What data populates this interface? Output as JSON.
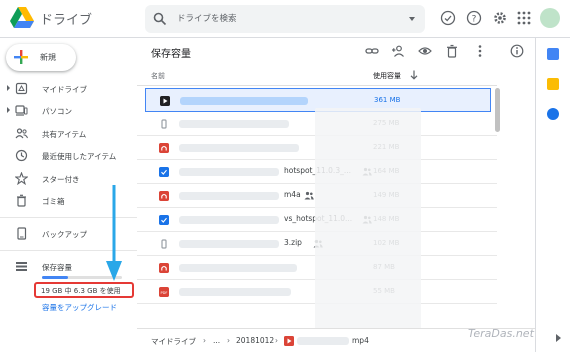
{
  "app": {
    "name": "ドライブ",
    "logo": "drive-logo"
  },
  "search": {
    "placeholder": "ドライブを検索"
  },
  "header_icons": [
    "offline-check-icon",
    "help-icon",
    "settings-icon",
    "apps-grid-icon",
    "account-avatar"
  ],
  "new_button": {
    "label": "新規"
  },
  "sidebar": {
    "items": [
      {
        "label": "マイドライブ",
        "icon": "my-drive-icon",
        "expandable": true
      },
      {
        "label": "パソコン",
        "icon": "computers-icon",
        "expandable": true
      },
      {
        "label": "共有アイテム",
        "icon": "shared-icon",
        "expandable": false
      },
      {
        "label": "最近使用したアイテム",
        "icon": "recent-icon",
        "expandable": false
      },
      {
        "label": "スター付き",
        "icon": "star-icon",
        "expandable": false
      },
      {
        "label": "ゴミ箱",
        "icon": "trash-icon",
        "expandable": false
      },
      {
        "label": "バックアップ",
        "icon": "backup-icon",
        "expandable": false
      },
      {
        "label": "保存容量",
        "icon": "storage-icon",
        "expandable": false
      }
    ],
    "storage": {
      "usage_text": "19 GB 中 6.3 GB を使用",
      "used_fraction": 0.33,
      "upgrade_label": "容量をアップグレード"
    }
  },
  "main": {
    "title": "保存容量",
    "toolbar": [
      "link-icon",
      "add-person-icon",
      "preview-eye-icon",
      "trash-icon",
      "more-vert-icon",
      "info-icon"
    ],
    "columns": {
      "name": "名前",
      "size": "使用容量"
    },
    "files": [
      {
        "name": "",
        "size": "361 MB",
        "type": "video",
        "color": "#202124",
        "selected": true,
        "shared": false
      },
      {
        "name": "",
        "size": "275 MB",
        "type": "generic",
        "color": "#9aa0a6",
        "selected": false,
        "shared": false
      },
      {
        "name": "",
        "size": "221 MB",
        "type": "audio",
        "color": "#db4437",
        "selected": false,
        "shared": false
      },
      {
        "name": "hotspot_11.0.3_...",
        "size": "164 MB",
        "type": "doc",
        "color": "#1a73e8",
        "selected": false,
        "shared": true
      },
      {
        "name": "m4a",
        "size": "149 MB",
        "type": "audio",
        "color": "#db4437",
        "selected": false,
        "shared": true
      },
      {
        "name": "vs_hotspot_11.0...",
        "size": "148 MB",
        "type": "doc",
        "color": "#1a73e8",
        "selected": false,
        "shared": true
      },
      {
        "name": "3.zip",
        "size": "102 MB",
        "type": "generic",
        "color": "#9aa0a6",
        "selected": false,
        "shared": true
      },
      {
        "name": "",
        "size": "87 MB",
        "type": "audio",
        "color": "#db4437",
        "selected": false,
        "shared": false
      },
      {
        "name": "",
        "size": "55 MB",
        "type": "pdf",
        "color": "#db4437",
        "selected": false,
        "shared": false
      }
    ],
    "breadcrumb": [
      "マイドライブ",
      "...",
      "20181012",
      "mp4"
    ]
  },
  "right_rail": [
    "calendar-icon",
    "keep-icon",
    "tasks-icon"
  ],
  "watermark": "TeraDas.net"
}
